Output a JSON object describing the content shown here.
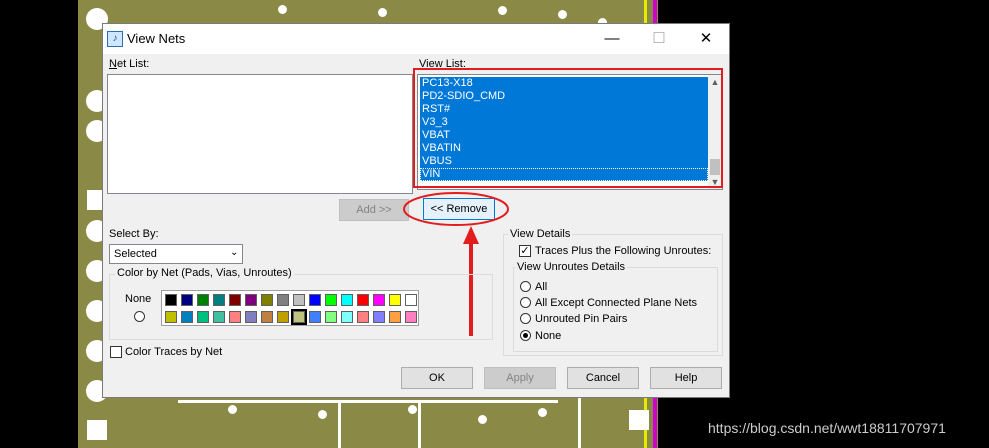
{
  "window": {
    "title": "View Nets",
    "minimize_glyph": "—",
    "maximize_glyph": "☐",
    "close_glyph": "✕",
    "icon": "app-icon"
  },
  "net_list": {
    "label_key": "N",
    "label_rest": "et List:"
  },
  "view_list": {
    "label": "View List:",
    "items": [
      "PC13-X18",
      "PD2-SDIO_CMD",
      "RST#",
      "V3_3",
      "VBAT",
      "VBATIN",
      "VBUS",
      "VIN"
    ],
    "selection_color": "#0078d7"
  },
  "buttons": {
    "add": "Add >>",
    "remove": "<< Remove",
    "ok": "OK",
    "apply": "Apply",
    "cancel": "Cancel",
    "help": "Help"
  },
  "select_by": {
    "label": "Select By:",
    "value": "Selected"
  },
  "color_by_net": {
    "title": "Color by Net (Pads, Vias, Unroutes)",
    "none_label": "None",
    "row1": [
      "#000000",
      "#000080",
      "#008000",
      "#008080",
      "#800000",
      "#800080",
      "#808000",
      "#808080",
      "#c0c0c0",
      "#0000ff",
      "#00ff00",
      "#00ffff",
      "#ff0000",
      "#ff00ff",
      "#ffff00",
      "#ffffff"
    ],
    "row2": [
      "#c0c000",
      "#0080c0",
      "#00c080",
      "#40c0a0",
      "#ff8080",
      "#8080c0",
      "#c08040",
      "#c0a000",
      "#c0c080",
      "#4080ff",
      "#80ff80",
      "#80ffff",
      "#ff8080",
      "#8080ff",
      "#ffa040",
      "#ff80c0"
    ]
  },
  "color_traces_by_net": "Color Traces by Net",
  "view_details": {
    "title": "View Details",
    "traces_label": "Traces Plus the Following Unroutes:",
    "traces_checked": "✓",
    "unroutes_title": "View Unroutes Details",
    "options": [
      "All",
      "All Except Connected Plane Nets",
      "Unrouted Pin Pairs",
      "None"
    ],
    "selected": "None"
  },
  "annotation": {
    "color": "#e31d1d"
  },
  "watermark": "https://blog.csdn.net/wwt18811707971"
}
